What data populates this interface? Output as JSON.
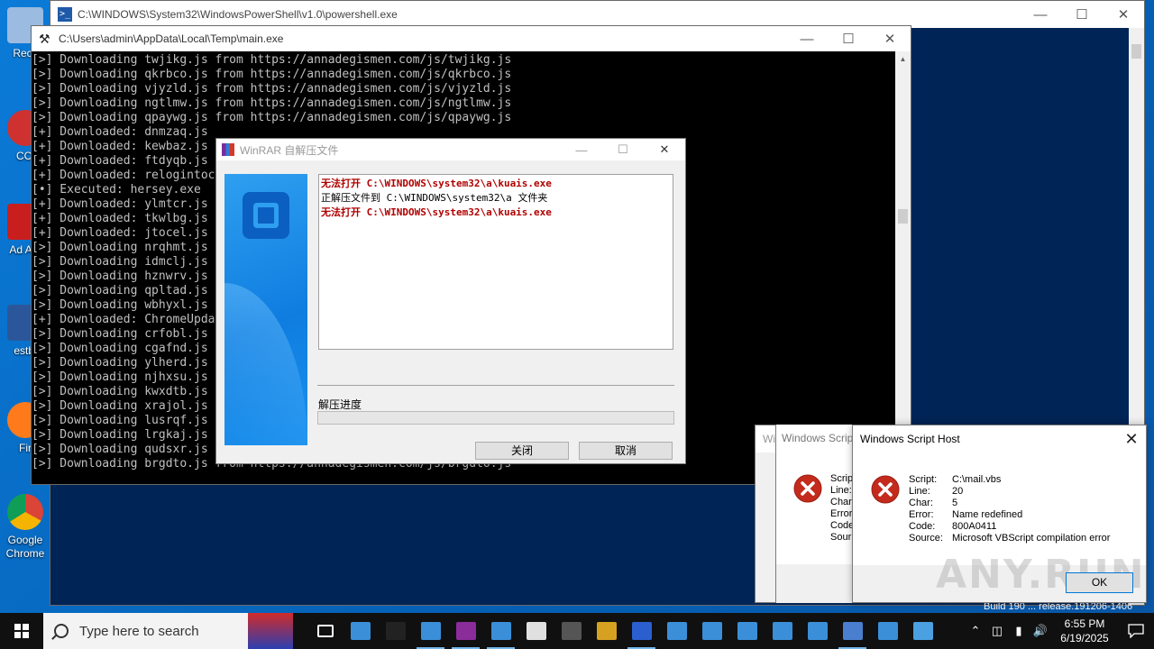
{
  "desktop": {
    "icons": [
      {
        "label": "Recy",
        "color": "#9bbbe0"
      },
      {
        "label": "CCl",
        "color": "#cf3131"
      },
      {
        "label": "Ad Acr",
        "color": "#c81e1e"
      },
      {
        "label": "estbl",
        "color": "#2b579a"
      },
      {
        "label": "Fir",
        "color": "#ff7a1a"
      },
      {
        "label": "Google Chrome",
        "color": "#2d8cf0"
      }
    ]
  },
  "powershell_window": {
    "title": "C:\\WINDOWS\\System32\\WindowsPowerShell\\v1.0\\powershell.exe"
  },
  "console_window": {
    "title": "C:\\Users\\admin\\AppData\\Local\\Temp\\main.exe",
    "lines": [
      "[>] Downloading twjikg.js from https://annadegismen.com/js/twjikg.js",
      "[>] Downloading qkrbco.js from https://annadegismen.com/js/qkrbco.js",
      "[>] Downloading vjyzld.js from https://annadegismen.com/js/vjyzld.js",
      "[>] Downloading ngtlmw.js from https://annadegismen.com/js/ngtlmw.js",
      "[>] Downloading qpaywg.js from https://annadegismen.com/js/qpaywg.js",
      "[+] Downloaded: dnmzaq.js",
      "[+] Downloaded: kewbaz.js",
      "[+] Downloaded: ftdyqb.js",
      "[+] Downloaded: relogintoc",
      "[•] Executed: hersey.exe",
      "[+] Downloaded: ylmtcr.js",
      "[+] Downloaded: tkwlbg.js",
      "[+] Downloaded: jtocel.js",
      "[>] Downloading nrqhmt.js",
      "[>] Downloading idmclj.js",
      "[>] Downloading hznwrv.js",
      "[>] Downloading qpltad.js",
      "[>] Downloading wbhyxl.js",
      "[+] Downloaded: ChromeUpda",
      "[>] Downloading crfobl.js",
      "[>] Downloading cgafnd.js",
      "[>] Downloading ylherd.js",
      "[>] Downloading njhxsu.js",
      "[>] Downloading kwxdtb.js",
      "[>] Downloading xrajol.js",
      "[>] Downloading lusrqf.js",
      "[>] Downloading lrgkaj.js",
      "[>] Downloading qudsxr.js",
      "[>] Downloading brgdto.js from https://annadegismen.com/js/brgdto.js"
    ]
  },
  "winrar": {
    "title": "WinRAR 自解压文件",
    "log": [
      {
        "text": "无法打开 C:\\WINDOWS\\system32\\a\\kuais.exe",
        "kind": "err"
      },
      {
        "text": "正解压文件到 C:\\WINDOWS\\system32\\a 文件夹",
        "kind": "info"
      },
      {
        "text": "无法打开 C:\\WINDOWS\\system32\\a\\kuais.exe",
        "kind": "err"
      }
    ],
    "progress_label": "解压进度",
    "progress": 0,
    "close_label": "关闭",
    "cancel_label": "取消"
  },
  "wsh_back": {
    "title_a": "Wi",
    "title_b": "Windows Scrip",
    "fields": [
      "Scrip",
      "Line:",
      "Char:",
      "Error",
      "Code",
      "Sour"
    ]
  },
  "wsh": {
    "title": "Windows Script Host",
    "fields": [
      {
        "key": "Script:",
        "value": "C:\\mail.vbs"
      },
      {
        "key": "Line:",
        "value": "20"
      },
      {
        "key": "Char:",
        "value": "5"
      },
      {
        "key": "Error:",
        "value": "Name redefined"
      },
      {
        "key": "Code:",
        "value": "800A0411"
      },
      {
        "key": "Source:",
        "value": "Microsoft VBScript compilation error"
      }
    ],
    "ok_label": "OK",
    "watermark": "ANY.RUN"
  },
  "desktop_build_text": "Build 190 ... release.191206-1406",
  "taskbar": {
    "search_placeholder": "Type here to search",
    "pinned": [
      {
        "name": "task-view-icon",
        "color": "#ffffff"
      },
      {
        "name": "app-icon-1",
        "color": "#3a8fd8"
      },
      {
        "name": "terminal-icon",
        "color": "#222222"
      },
      {
        "name": "window-icon-1",
        "color": "#3a8fd8"
      },
      {
        "name": "winrar-icon",
        "color": "#8b2c9b"
      },
      {
        "name": "window-icon-2",
        "color": "#3a8fd8"
      },
      {
        "name": "ccleaner-icon",
        "color": "#e0e0e0"
      },
      {
        "name": "settings-icon",
        "color": "#555555"
      },
      {
        "name": "archive-icon",
        "color": "#d6a020"
      },
      {
        "name": "keepass-icon",
        "color": "#2b5fd0"
      },
      {
        "name": "window-icon-3",
        "color": "#3a8fd8"
      },
      {
        "name": "window-icon-4",
        "color": "#3a8fd8"
      },
      {
        "name": "window-icon-5",
        "color": "#3a8fd8"
      },
      {
        "name": "window-icon-6",
        "color": "#3a8fd8"
      },
      {
        "name": "window-icon-7",
        "color": "#3a8fd8"
      },
      {
        "name": "script-icon",
        "color": "#4a7fd0"
      },
      {
        "name": "app-icon-2",
        "color": "#3a8fd8"
      },
      {
        "name": "network-app-icon",
        "color": "#4aa0e0"
      }
    ],
    "time": "6:55 PM",
    "date": "6/19/2025"
  }
}
